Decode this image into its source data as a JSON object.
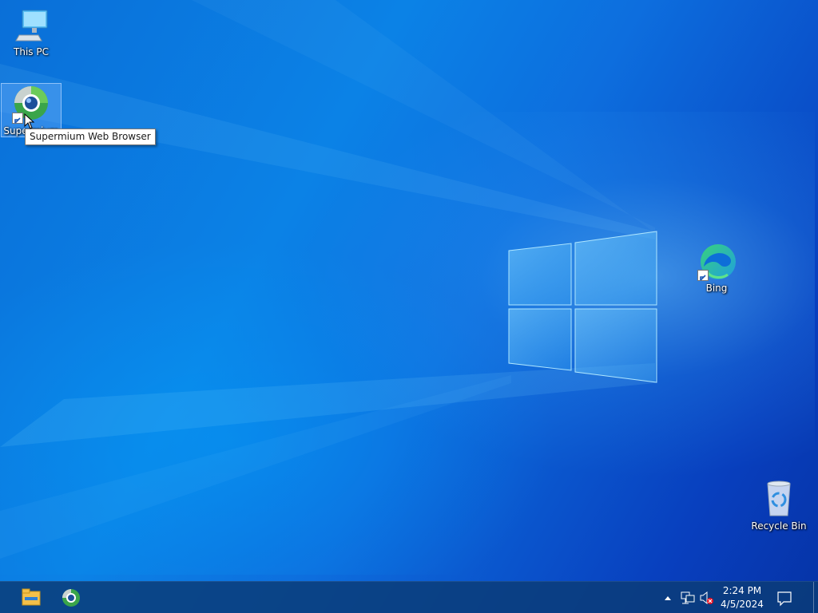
{
  "desktop": {
    "icons": [
      {
        "label": "This PC",
        "icon": "this-pc-icon"
      },
      {
        "label": "Supermium",
        "icon": "supermium-browser-icon",
        "shortcut": true,
        "selected": true
      },
      {
        "label": "Bing",
        "icon": "edge-bing-icon",
        "shortcut": true
      },
      {
        "label": "Recycle Bin",
        "icon": "recycle-bin-icon"
      }
    ],
    "tooltip": "Supermium Web Browser"
  },
  "taskbar": {
    "pinned": [
      {
        "name": "File Explorer",
        "icon": "file-explorer-icon"
      },
      {
        "name": "Supermium",
        "icon": "supermium-browser-icon"
      }
    ],
    "tray": {
      "overflow_icon": "chevron-up-icon",
      "network_icon": "network-wired-icon",
      "volume_icon": "volume-muted-icon",
      "time": "2:24 PM",
      "date": "4/5/2024",
      "notification_icon": "action-center-icon"
    }
  }
}
